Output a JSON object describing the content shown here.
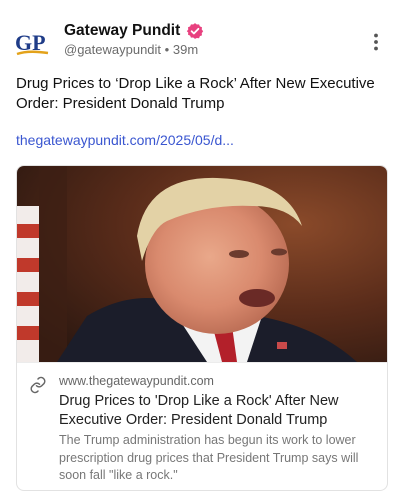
{
  "post": {
    "author_name": "Gateway Pundit",
    "avatar_text": "GP",
    "handle": "@gatewaypundit",
    "separator": "•",
    "time": "39m",
    "text": "Drug Prices to ‘Drop Like a Rock’ After New Executive Order: President Donald Trump",
    "link": "thegatewaypundit.com/2025/05/d..."
  },
  "preview": {
    "domain": "www.thegatewaypundit.com",
    "title": "Drug Prices to 'Drop Like a Rock' After New Executive Order: President Donald Trump",
    "description": "The Trump administration has begun its work to lower prescription drug prices that President Trump says will soon fall \"like a rock.\""
  },
  "icons": {
    "verified": "verified-badge-icon",
    "menu": "more-vertical-icon",
    "link": "link-icon"
  },
  "colors": {
    "link": "#3a56d0",
    "badge": "#e8417f",
    "logo_blue": "#1f3c88",
    "logo_gold": "#e3a21a"
  }
}
